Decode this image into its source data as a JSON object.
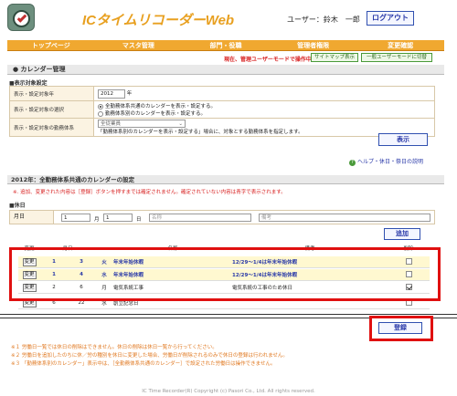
{
  "header": {
    "app_title": "ICタイムリコーダーWeb",
    "user_label": "ユーザー：鈴木　一郎",
    "logout_label": "ログアウト"
  },
  "nav": {
    "items": [
      "トップページ",
      "マスタ管理",
      "部門・役職",
      "管理者権限",
      "変更確認"
    ]
  },
  "notice": {
    "warning": "現在、管理ユーザーモードで操作中です。",
    "sitemap_label": "サイトマップ表示",
    "switch_label": "一般ユーザーモードに切替"
  },
  "calendar": {
    "section_title": "● カレンダー管理",
    "sub_title": "■表示対象設定",
    "year_label": "表示・設定対象年",
    "year_value": "2012",
    "year_unit": "年",
    "selection_label": "表示・設定対象の選択",
    "option_common": "全勤務体系共通のカレンダーを表示・設定する。",
    "option_specific": "勤務体系別のカレンダーを表示・設定する。",
    "worktype_label": "表示・設定対象の勤務体系",
    "worktype_select": "全従業員",
    "worktype_note": "「勤務体系別のカレンダーを表示・設定する」場合に、対象とする勤務体系を指定します。",
    "display_button": "表示",
    "help_link": "ヘルプ・休日・祭日の説明"
  },
  "year_calendar": {
    "title": "2012年：全勤務体系共通のカレンダーの設定",
    "note": "※. 追加、変更された内容は［登録］ボタンを押すまでは確定されません。確定されていない内容は青字で表示されます。",
    "holiday_title": "■休日",
    "date_label": "月日",
    "month_value": "1",
    "month_unit": "月",
    "day_value": "1",
    "day_unit": "日",
    "name_placeholder": "名称",
    "memo_placeholder": "備考",
    "add_button": "追加"
  },
  "holiday_table": {
    "headers": [
      "変更",
      "月日",
      "",
      "",
      "名称",
      "備考",
      "削除"
    ],
    "rows": [
      {
        "edit": "変更",
        "month": "1",
        "day": "3",
        "dow": "火",
        "name": "年末年始休暇",
        "memo": "12/29～1/4は年末年始休暇",
        "checked": false,
        "highlight": true
      },
      {
        "edit": "変更",
        "month": "1",
        "day": "4",
        "dow": "水",
        "name": "年末年始休暇",
        "memo": "12/29～1/4は年末年始休暇",
        "checked": false,
        "highlight": true
      },
      {
        "edit": "変更",
        "month": "2",
        "day": "6",
        "dow": "月",
        "name": "電気系統工事",
        "memo": "電気系統の工事のため休日",
        "checked": true,
        "highlight": false
      },
      {
        "edit": "変更",
        "month": "6",
        "day": "22",
        "dow": "水",
        "name": "創立記念日",
        "memo": "",
        "checked": false,
        "highlight": false
      }
    ]
  },
  "register": {
    "button": "登録"
  },
  "footnotes": [
    "※１ 労働日一覧では休日の削除はできません。休日の削除は休日一覧から行ってください。",
    "※２ 労働日を追加したのちに休／労の種別を休日に変更した場合、労働日が削除されるのみで休日の登録は行われません。",
    "※３ 「勤務体系別のカレンダー」表示中は、［全勤務体系共通のカレンダー］で設定された労働日は操作できません。"
  ],
  "copyright": "IC Time Recorder(R) Copyright (c) Pasori Co., Ltd. All rights reserved."
}
